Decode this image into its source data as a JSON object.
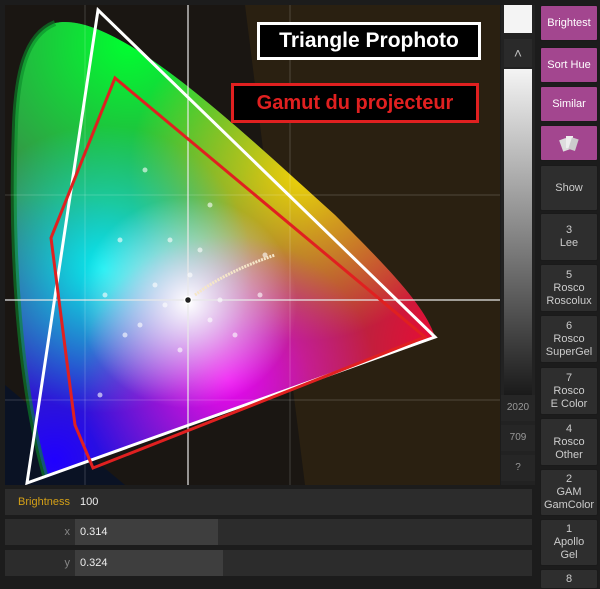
{
  "diagram": {
    "prophoto_label": "Triangle Prophoto",
    "projector_label": "Gamut du projecteur",
    "colors": {
      "prophoto": "#ffffff",
      "projector": "#e02020"
    }
  },
  "slider": {
    "up_arrow": "˄",
    "marks": [
      "2020",
      "709",
      "?"
    ]
  },
  "buttons": [
    {
      "lines": [
        "Brightest"
      ],
      "style": "pink"
    },
    {
      "lines": [
        "Sort Hue"
      ],
      "style": "pink"
    },
    {
      "lines": [
        "Similar"
      ],
      "style": "pink"
    },
    {
      "lines": [],
      "style": "pink",
      "icon": "swatch-fan-icon"
    },
    {
      "lines": [
        "Show"
      ],
      "style": "dark"
    },
    {
      "lines": [
        "3",
        "Lee"
      ],
      "style": "dark"
    },
    {
      "lines": [
        "5",
        "Rosco",
        "Roscolux"
      ],
      "style": "dark"
    },
    {
      "lines": [
        "6",
        "Rosco",
        "SuperGel"
      ],
      "style": "dark"
    },
    {
      "lines": [
        "7",
        "Rosco",
        "E Color"
      ],
      "style": "dark"
    },
    {
      "lines": [
        "4",
        "Rosco",
        "Other"
      ],
      "style": "dark"
    },
    {
      "lines": [
        "2",
        "GAM",
        "GamColor"
      ],
      "style": "dark"
    },
    {
      "lines": [
        "1",
        "Apollo",
        "Gel"
      ],
      "style": "dark"
    },
    {
      "lines": [
        "8"
      ],
      "style": "dark"
    }
  ],
  "rows": {
    "brightness": {
      "label": "Brightness",
      "value": "100",
      "label_color": "#d4a017",
      "fill": 0
    },
    "x": {
      "label": "x",
      "value": "0.314",
      "label_color": "#888888",
      "fill": 0.314
    },
    "y": {
      "label": "y",
      "value": "0.324",
      "label_color": "#888888",
      "fill": 0.324
    }
  }
}
